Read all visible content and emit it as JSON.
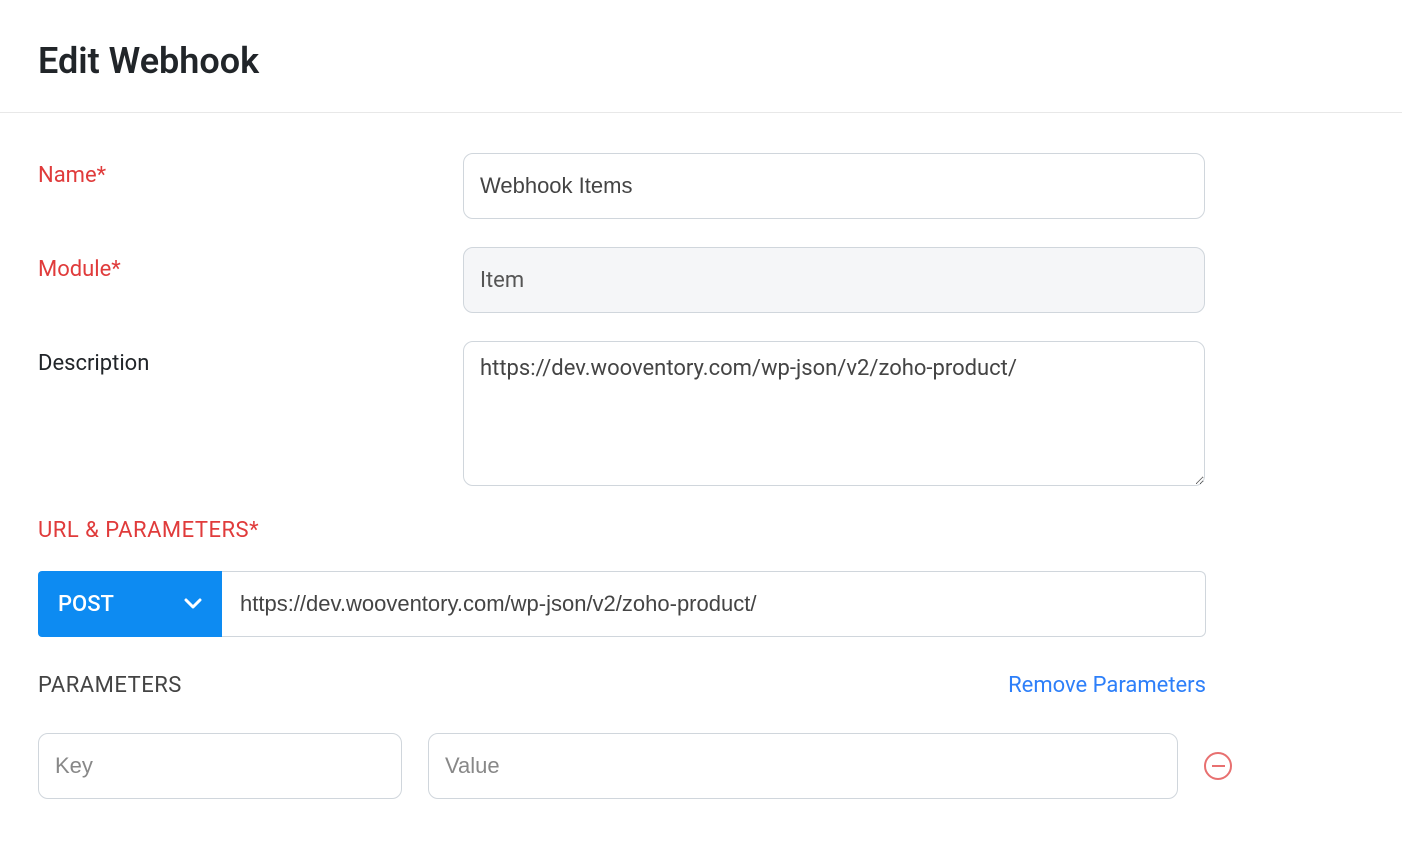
{
  "page_title": "Edit Webhook",
  "fields": {
    "name": {
      "label": "Name*",
      "value": "Webhook Items"
    },
    "module": {
      "label": "Module*",
      "value": "Item"
    },
    "description": {
      "label": "Description",
      "value": "https://dev.wooventory.com/wp-json/v2/zoho-product/"
    }
  },
  "url_section": {
    "heading": "URL & PARAMETERS*",
    "method": "POST",
    "url": "https://dev.wooventory.com/wp-json/v2/zoho-product/"
  },
  "parameters": {
    "heading": "PARAMETERS",
    "remove_link": "Remove Parameters",
    "key_placeholder": "Key",
    "value_placeholder": "Value"
  }
}
